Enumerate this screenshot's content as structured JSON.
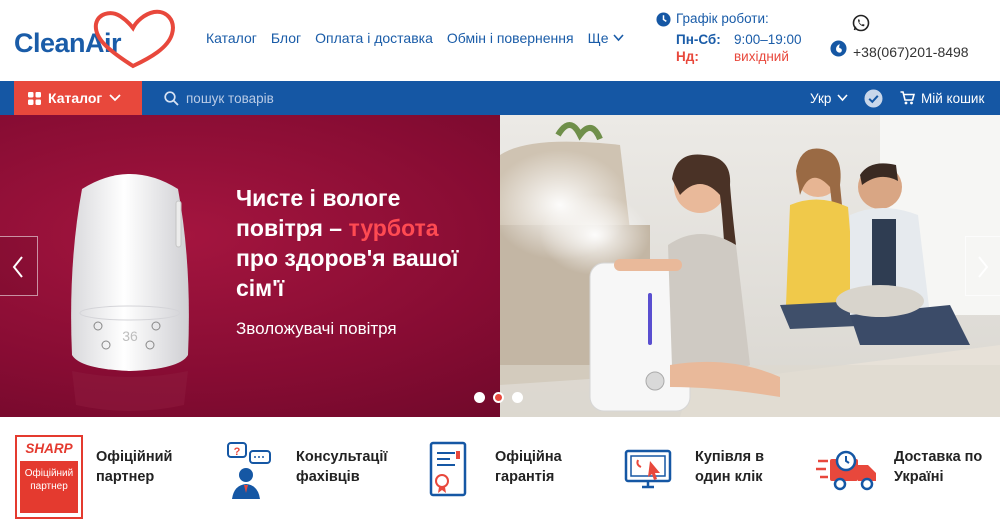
{
  "brand": {
    "logo_text": "CleanAir"
  },
  "nav": {
    "items": [
      {
        "label": "Каталог"
      },
      {
        "label": "Блог"
      },
      {
        "label": "Оплата і доставка"
      },
      {
        "label": "Обмін і повернення"
      }
    ],
    "more_label": "Ще"
  },
  "schedule": {
    "title": "Графік роботи:",
    "weekdays_label": "Пн-Сб:",
    "weekdays_hours": "9:00–19:00",
    "sunday_label": "Нд:",
    "sunday_hours": "вихідний"
  },
  "contact": {
    "phone": "+38(067)201-8498"
  },
  "toolbar": {
    "catalog_label": "Каталог",
    "search_placeholder": "пошук товарів",
    "language": "Укр",
    "cart_label": "Мій кошик"
  },
  "banner": {
    "headline_line1": "Чисте і вологе",
    "headline_line2_a": "повітря – ",
    "headline_line2_b": "турбота",
    "headline_line3": "про здоров'я вашої",
    "headline_line4": "сім'ї",
    "subtitle": "Зволожувачі повітря",
    "device_display": "36",
    "slides": 3,
    "active_slide": 2
  },
  "features": [
    {
      "line1": "Офіційний",
      "line2": "партнер"
    },
    {
      "line1": "Консультації",
      "line2": "фахівців"
    },
    {
      "line1": "Офіційна",
      "line2": "гарантія"
    },
    {
      "line1": "Купівля в",
      "line2": "один клік"
    },
    {
      "line1": "Доставка по",
      "line2": "Україні"
    }
  ],
  "partner_badge": {
    "brand": "SHARP",
    "line1": "Офіційний",
    "line2": "партнер"
  },
  "colors": {
    "brand_blue": "#1557a4",
    "accent_red": "#e8483c",
    "banner_bg": "#8a0d34"
  }
}
